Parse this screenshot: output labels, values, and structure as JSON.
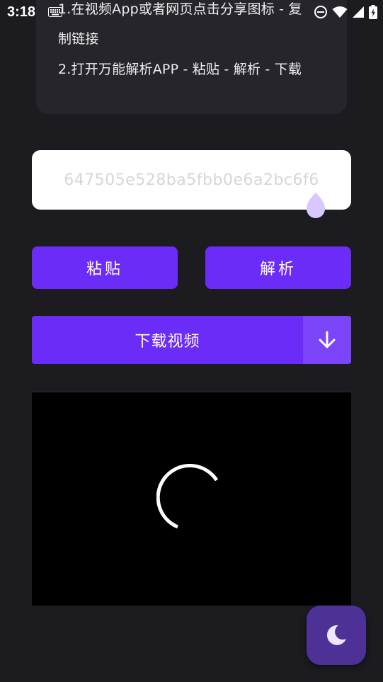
{
  "status_bar": {
    "time": "3:18"
  },
  "instructions": {
    "step1_line1": "1.在视频App或者网页点击分享图标 - 复",
    "step1_line2": "制链接",
    "step2": "2.打开万能解析APP - 粘贴 - 解析 - 下载"
  },
  "link_input": {
    "placeholder": "647505e528ba5fbb0e6a2bc6f6"
  },
  "buttons": {
    "paste_label": "粘贴",
    "parse_label": "解析",
    "download_label": "下载视频"
  },
  "icons": {
    "download": "arrow-down-icon",
    "fab": "moon-icon",
    "video_state": "loading-spinner-icon"
  },
  "colors": {
    "background": "#1c1b20",
    "card": "#26252b",
    "accent": "#6c2cf7",
    "accent_light": "#7c44f8",
    "fab": "#4e3196",
    "cursor_handle": "#d9c8ff"
  }
}
